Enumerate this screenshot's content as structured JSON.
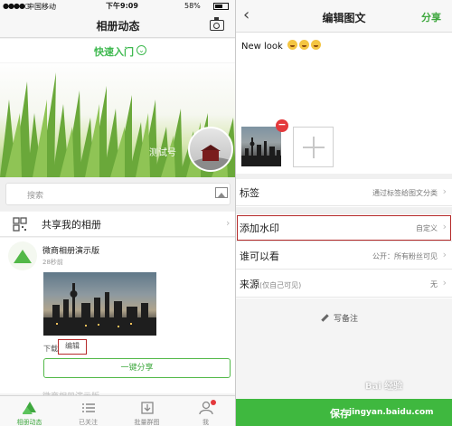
{
  "left": {
    "status": {
      "carrier": "中国移动",
      "time": "下午9:09",
      "battery": "58%"
    },
    "nav": {
      "title": "相册动态"
    },
    "quick_entry": {
      "label": "快速入门"
    },
    "cover": {
      "account_name": "测试号"
    },
    "search": {
      "placeholder": "搜索"
    },
    "shared_album": {
      "label": "共享我的相册"
    },
    "post": {
      "author": "微商相册演示版",
      "time_ago": "28秒前",
      "download_label": "下载",
      "edit_label": "编辑",
      "share_button": "一键分享",
      "next_author": "微商相册演示版"
    },
    "tabs": [
      {
        "label": "相册动态",
        "icon": "album-tree-icon"
      },
      {
        "label": "已关注",
        "icon": "list-icon"
      },
      {
        "label": "批量群图",
        "icon": "batch-download-icon"
      },
      {
        "label": "我",
        "icon": "person-icon"
      }
    ],
    "active_tab": 0
  },
  "right": {
    "nav": {
      "back": "‹",
      "title": "编辑图文",
      "action": "分享"
    },
    "content_text": "New look",
    "emoji_count": 3,
    "rows": [
      {
        "key": "标签",
        "key_note": "",
        "value": "通过标签给图文分类"
      },
      {
        "key": "添加水印",
        "key_note": "",
        "value": "自定义"
      },
      {
        "key": "谁可以看",
        "key_note": "",
        "value": "公开：所有粉丝可见"
      },
      {
        "key": "来源",
        "key_note": "(仅自己可见)",
        "value": "无"
      }
    ],
    "highlighted_row": "添加水印",
    "note_label": "写备注",
    "save_label": "保存",
    "watermark": "Bai 经验",
    "watermark_url": "jingyan.baidu.com"
  },
  "colors": {
    "brand_green": "#3fb83f",
    "highlight_red": "#b52a2a",
    "badge_red": "#e4393c"
  }
}
